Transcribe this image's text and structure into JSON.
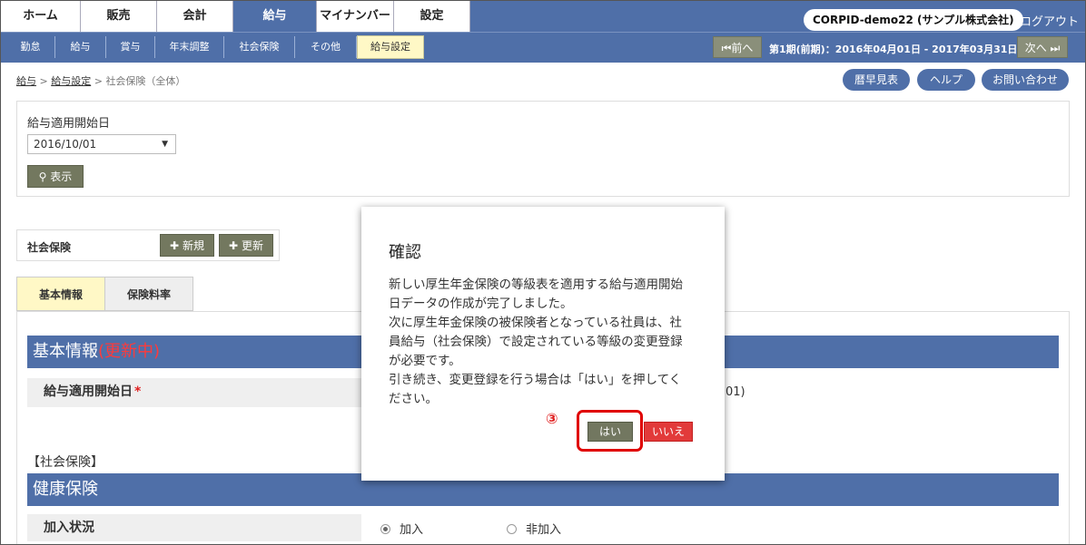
{
  "topnav": {
    "tabs": [
      "ホーム",
      "販売",
      "会計",
      "給与",
      "マイナンバー",
      "設定"
    ],
    "corp": "CORPID-demo22 (サンプル株式会社)",
    "logout": "▲ログアウト"
  },
  "subnav": {
    "items": [
      "勤怠",
      "給与",
      "賞与",
      "年末調整",
      "社会保険",
      "その他",
      "給与設定"
    ],
    "prev": "⏮前へ",
    "next": "次へ ⏭",
    "period": "第1期(前期)：2016年04月01日 - 2017年03月31日"
  },
  "breadcrumb": {
    "c1": "給与",
    "sep": ">",
    "c2": "給与設定",
    "c3": "社会保険（全体）"
  },
  "header_buttons": {
    "calendar": "暦早見表",
    "help": "ヘルプ",
    "contact": "お問い合わせ"
  },
  "filter": {
    "label": "給与適用開始日",
    "selected": "2016/10/01",
    "show_button": "表示"
  },
  "social": {
    "label": "社会保険",
    "new_button": "新規",
    "update_button": "更新"
  },
  "tabs": {
    "basic": "基本情報",
    "rate": "保険料率"
  },
  "basic": {
    "title": "基本情報",
    "status": "(更新中)",
    "start_label": "給与適用開始日",
    "required_mark": "*",
    "partial_value": "01)"
  },
  "section_label": "【社会保険】",
  "health": {
    "title": "健康保険",
    "join_label": "加入状況",
    "opt_join": "加入",
    "opt_nonjoin": "非加入"
  },
  "modal": {
    "title": "確認",
    "message": [
      "新しい厚生年金保険の等級表を適用する給与適用開始",
      "日データの作成が完了しました。",
      "次に厚生年金保険の被保険者となっている社員は、社",
      "員給与（社会保険）で設定されている等級の変更登録",
      "が必要です。",
      "引き続き、変更登録を行う場合は「はい」を押してく",
      "ださい。"
    ],
    "yes": "はい",
    "no": "いいえ",
    "annotation": "③"
  },
  "colors": {
    "nav": "#4f6fa8",
    "accent_red": "#e23a3a",
    "active_sub": "#fff8c6",
    "olive_button": "#727760"
  }
}
